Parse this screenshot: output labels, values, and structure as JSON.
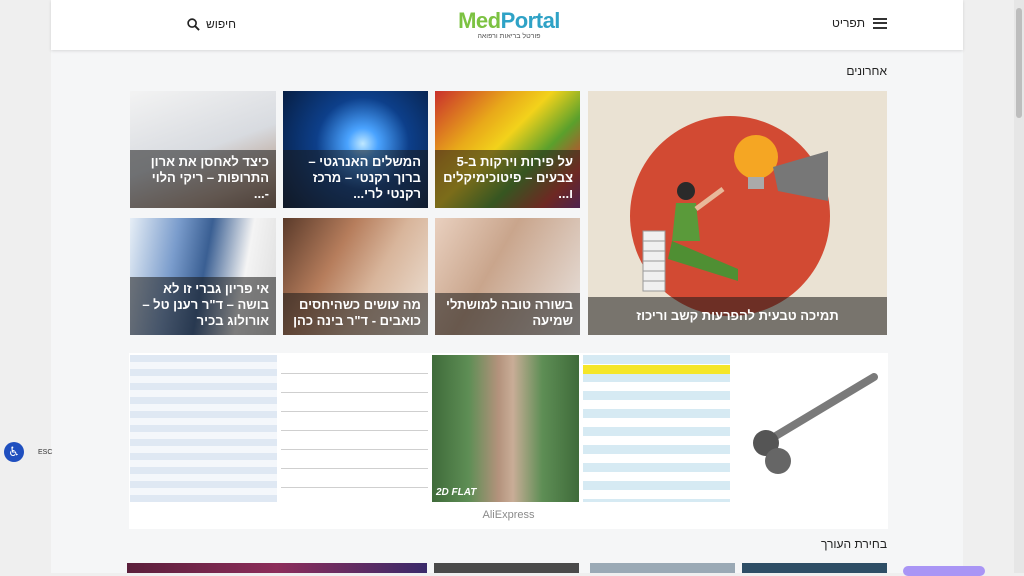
{
  "header": {
    "menu_label": "תפריט",
    "search_label": "חיפוש",
    "logo_med": "Med",
    "logo_portal": "Portal",
    "logo_tagline": "פורטל בריאות ורפואה"
  },
  "recent": {
    "title": "אחרונים",
    "featured_caption": "תמיכה טבעית להפרעות קשב וריכוז",
    "cards": [
      {
        "caption": "על פירות וירקות ב-5 צבעים – פיטוכימיקלים ו..."
      },
      {
        "caption": "המשלים האנרגטי – ברוך רקנטי – מרכז רקנטי לרי..."
      },
      {
        "caption": "כיצד לאחסן את ארון התרופות – ריקי הלוי -..."
      },
      {
        "caption": "בשורה טובה למושתלי שמיעה"
      },
      {
        "caption": "מה עושים כשהיחסים כואבים - ד\"ר בינה כהן"
      },
      {
        "caption": "אי פריון גברי זו לא בושה – ד\"ר רענן טל – אורולוג בכיר"
      }
    ]
  },
  "ad": {
    "brand": "AliExpress",
    "badge": "2D FLAT"
  },
  "editor": {
    "title": "בחירת העורך"
  },
  "accessibility": {
    "esc_label": "ESC"
  },
  "colors": {
    "logo_green": "#7cc242",
    "logo_blue": "#2fa2c6",
    "accessibility_blue": "#1f4fbf"
  }
}
